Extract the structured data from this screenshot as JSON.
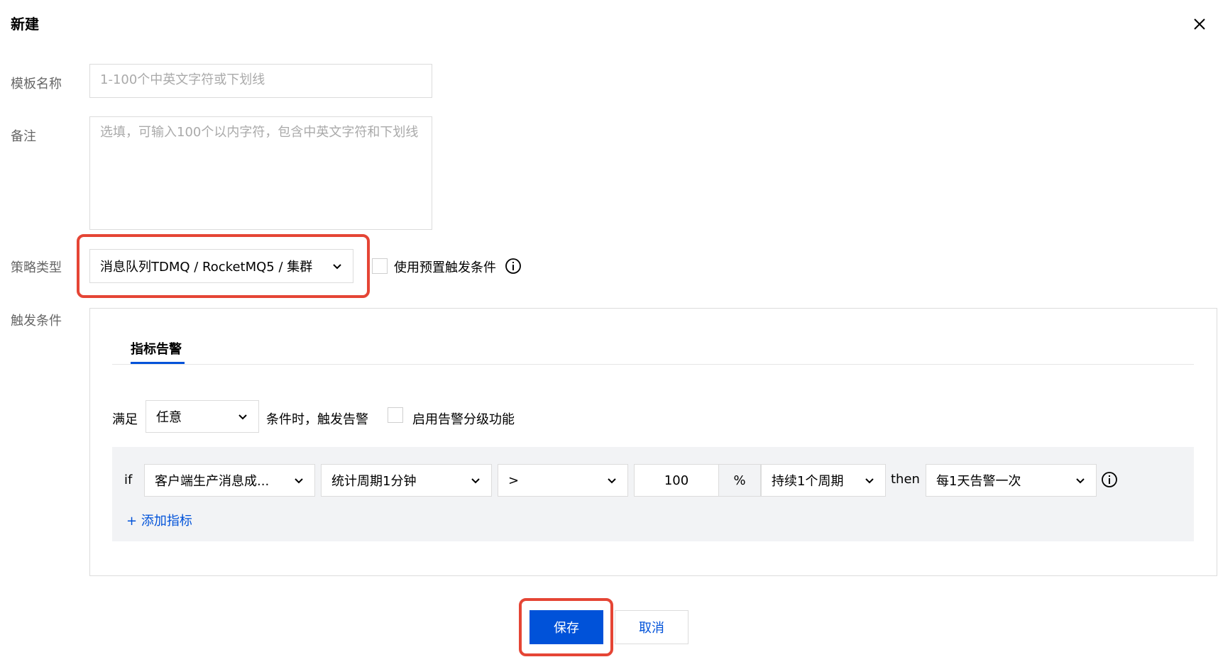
{
  "dialog": {
    "title": "新建"
  },
  "form": {
    "template_name_label": "模板名称",
    "template_name_placeholder": "1-100个中英文字符或下划线",
    "remark_label": "备注",
    "remark_placeholder": "选填，可输入100个以内字符，包含中英文字符和下划线",
    "policy_type_label": "策略类型",
    "policy_type_value": "消息队列TDMQ / RocketMQ5 / 集群",
    "use_preset_label": "使用预置触发条件",
    "trigger_label": "触发条件"
  },
  "trigger": {
    "tab_label": "指标告警",
    "satisfy_label": "满足",
    "satisfy_value": "任意",
    "condition_text": "条件时，触发告警",
    "grading_label": "启用告警分级功能",
    "rule": {
      "if_label": "if",
      "metric": "客户端生产消息成...",
      "period": "统计周期1分钟",
      "operator": ">",
      "threshold": "100",
      "unit": "%",
      "duration": "持续1个周期",
      "then_label": "then",
      "frequency": "每1天告警一次"
    },
    "add_metric_label": "添加指标",
    "add_metric_plus": "+"
  },
  "footer": {
    "save_label": "保存",
    "cancel_label": "取消"
  },
  "colors": {
    "primary": "#0052d9",
    "highlight": "#e54535"
  }
}
